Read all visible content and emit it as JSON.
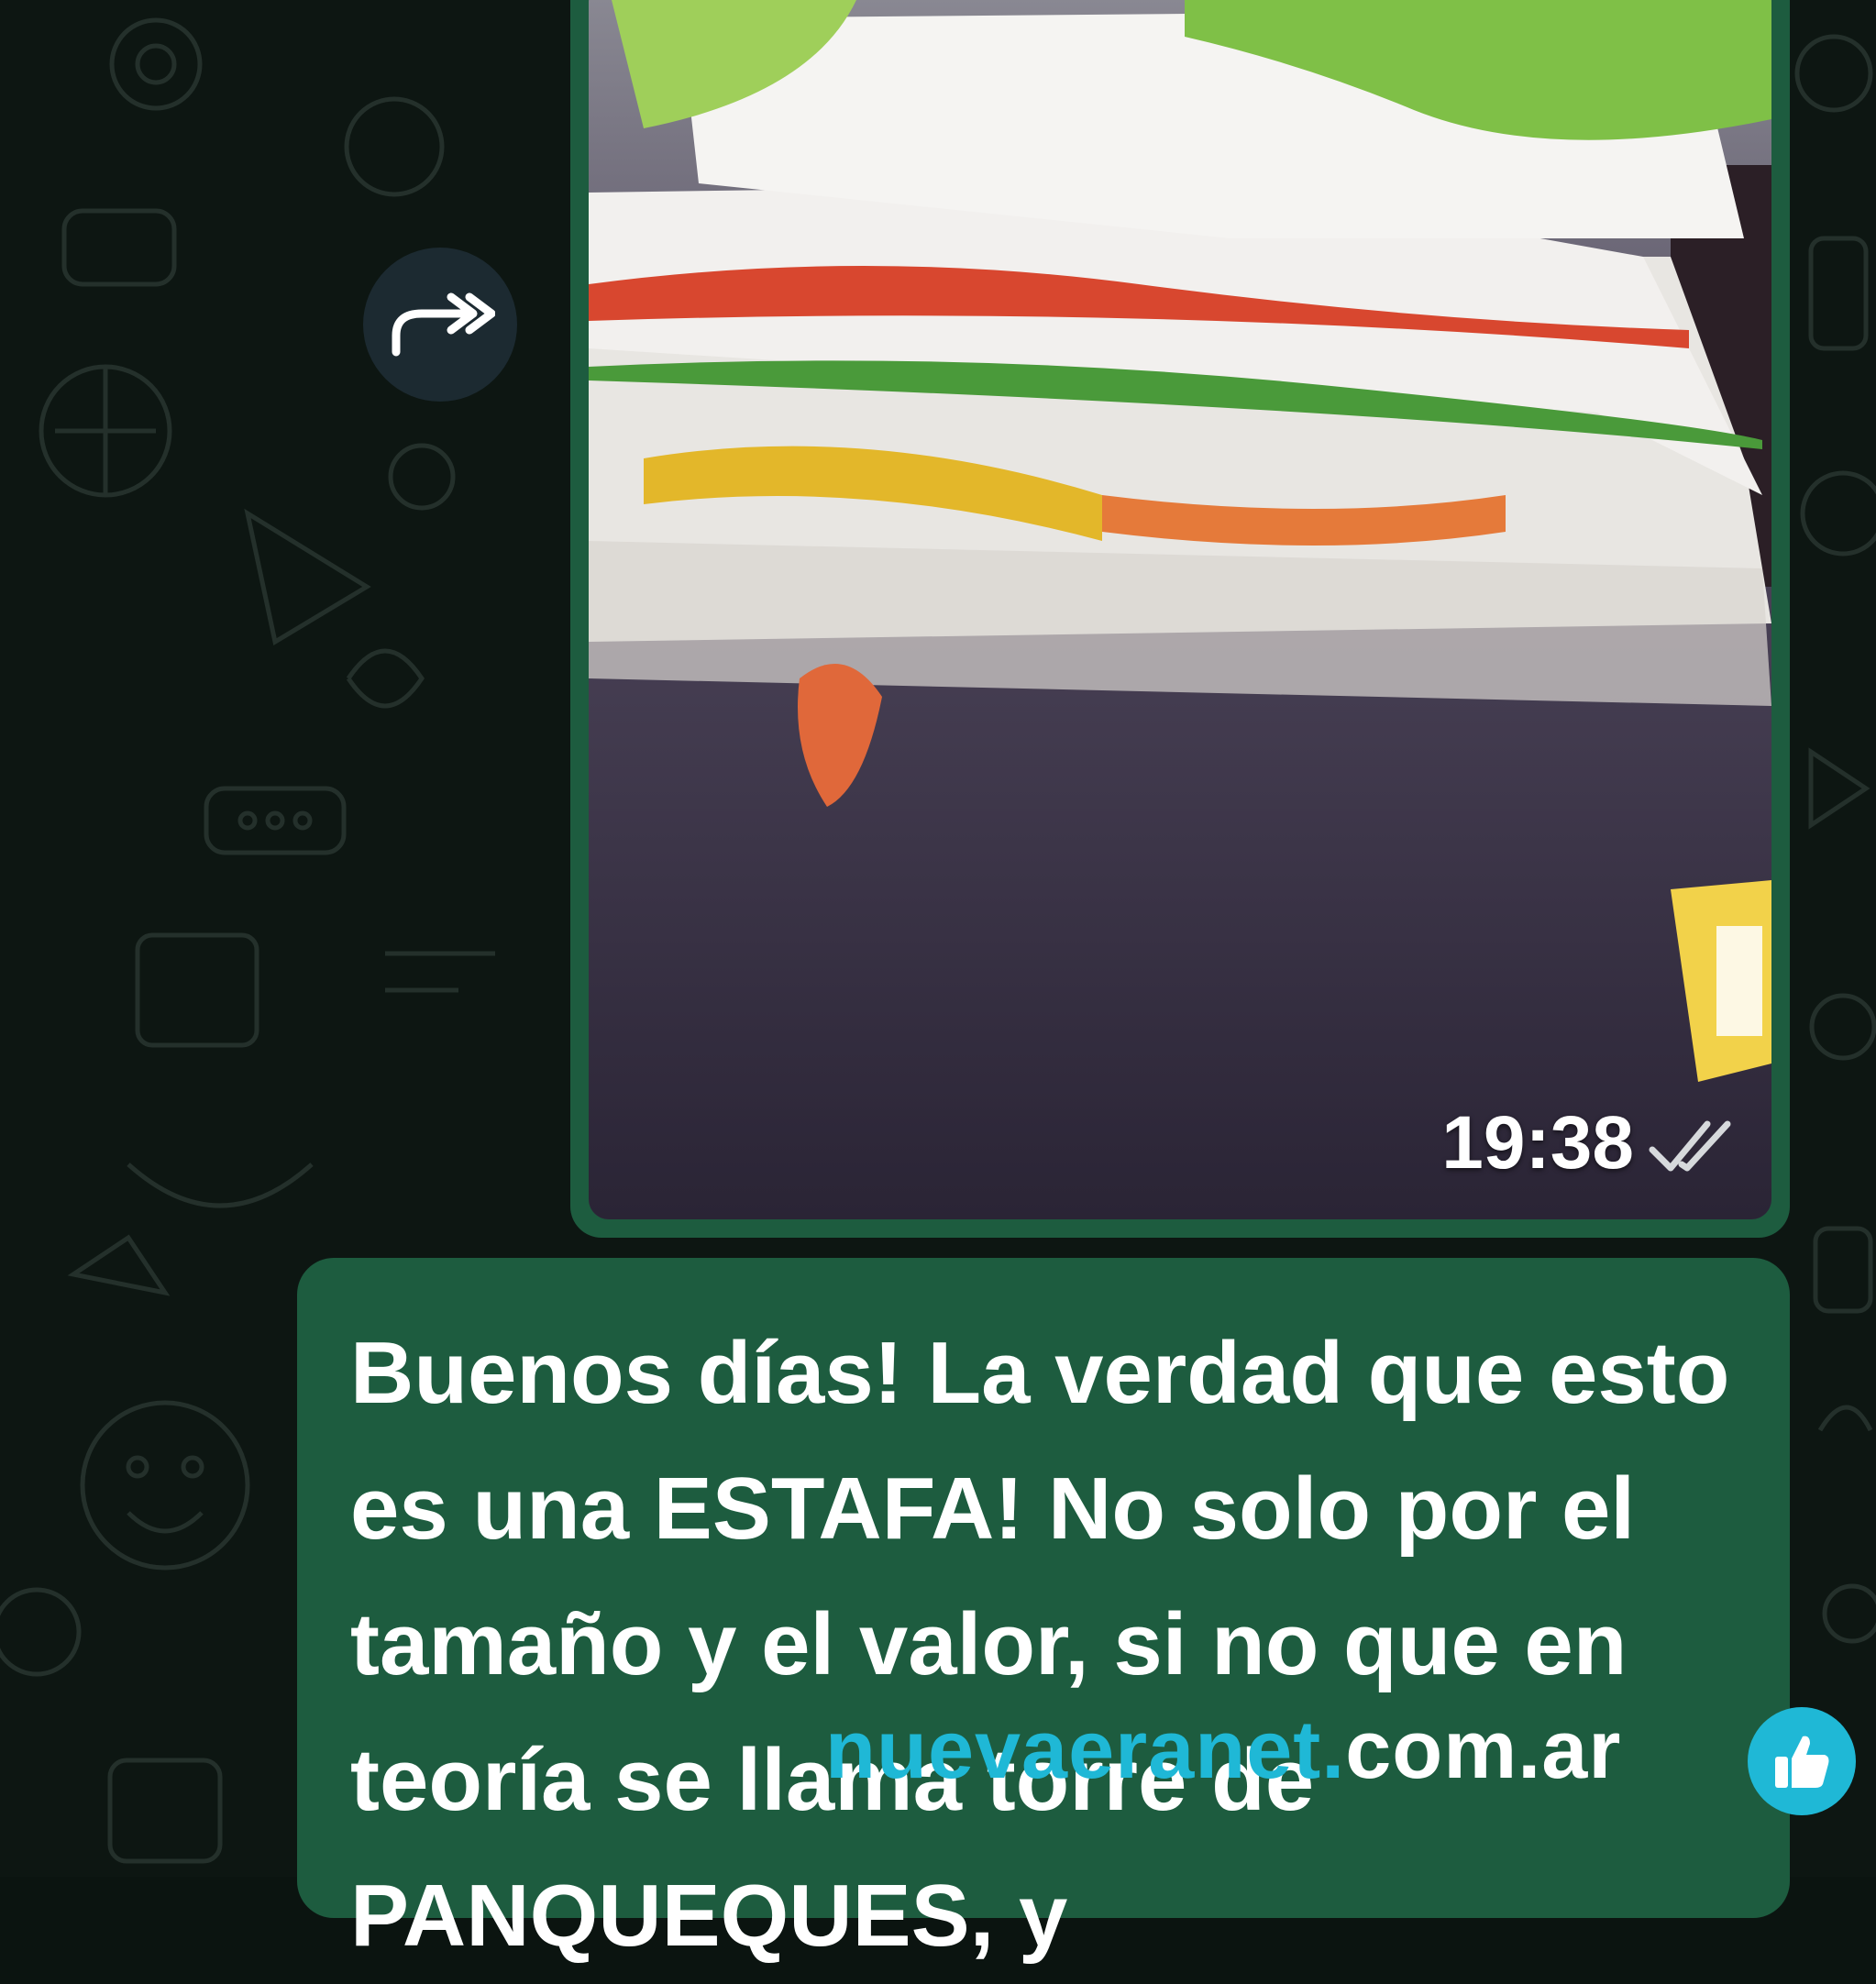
{
  "chat": {
    "image_message": {
      "time": "19:38",
      "status_icon": "double-check-icon"
    },
    "text_message": {
      "text": "Buenos días! La verdad que esto es una ESTAFA! No solo por el tamaño y el valor, si no que en teoría se llama torre de PANQUEQUES, y"
    },
    "forward_icon": "forward-arrow-icon"
  },
  "watermark": {
    "part1": "nuevaeranet.",
    "part2": "com.ar",
    "icon": "thumbs-up-icon"
  },
  "colors": {
    "bubble": "#1d5c3f",
    "background": "#0d1612",
    "watermark_accent": "#1fb8d6"
  }
}
